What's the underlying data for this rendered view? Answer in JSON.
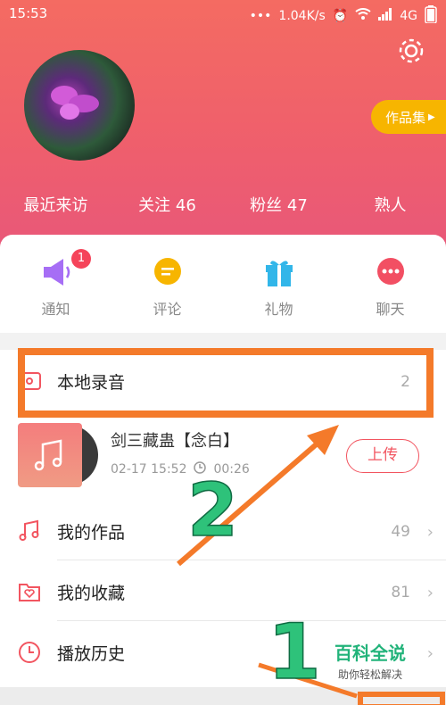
{
  "statusbar": {
    "time": "15:53",
    "speed": "1.04K/s",
    "network": "4G"
  },
  "profile": {
    "works_label": "作品集",
    "stats": [
      {
        "label": "最近来访"
      },
      {
        "label": "关注 46"
      },
      {
        "label": "粉丝 47"
      },
      {
        "label": "熟人"
      }
    ]
  },
  "actions": [
    {
      "label": "通知",
      "badge": "1",
      "icon": "speaker-icon",
      "color": "#a66ef5"
    },
    {
      "label": "评论",
      "icon": "comment-icon",
      "color": "#f7b500"
    },
    {
      "label": "礼物",
      "icon": "gift-icon",
      "color": "#32b6e9"
    },
    {
      "label": "聊天",
      "icon": "chat-icon",
      "color": "#f24f63"
    }
  ],
  "list": {
    "local": {
      "title": "本地录音",
      "count": "2"
    },
    "track": {
      "name": "剑三藏蛊【念白】",
      "date": "02-17 15:52",
      "duration": "00:26",
      "upload": "上传"
    },
    "works": {
      "title": "我的作品",
      "count": "49"
    },
    "favorites": {
      "title": "我的收藏",
      "count": "81"
    },
    "history": {
      "title": "播放历史"
    }
  },
  "annotations": {
    "num1": "1",
    "num2": "2"
  },
  "watermark": {
    "title": "百科全说",
    "subtitle": "助你轻松解决"
  },
  "colors": {
    "accent": "#f25560",
    "highlight": "#f47a2a",
    "arrow_number": "#2ec27a"
  }
}
